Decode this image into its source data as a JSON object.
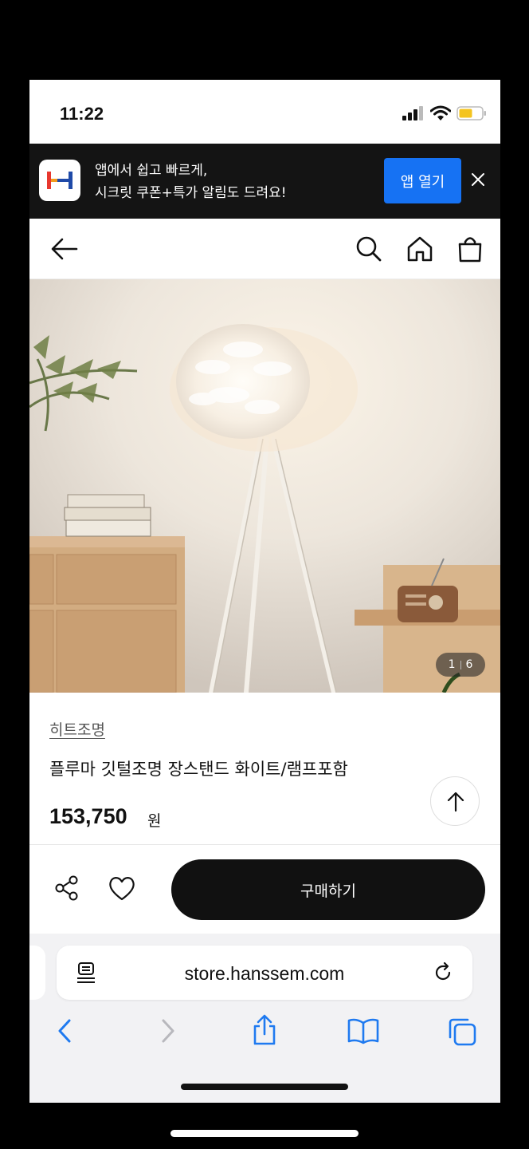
{
  "status_bar": {
    "time": "11:22"
  },
  "app_banner": {
    "line1": "앱에서 쉽고 빠르게,",
    "line2": "시크릿 쿠폰+특가 알림도 드려요!",
    "open_button": "앱 열기",
    "accent": "#1672f3"
  },
  "header": {
    "icons": [
      "back-arrow-icon",
      "search-icon",
      "home-icon",
      "shopping-bag-icon"
    ]
  },
  "gallery": {
    "current": "1",
    "total": "6"
  },
  "product": {
    "brand": "히트조명",
    "title": "플루마 깃털조명 장스탠드 화이트/램프포함",
    "price": "153,750",
    "currency": "원"
  },
  "actions": {
    "buy_label": "구매하기"
  },
  "browser": {
    "url": "store.hanssem.com",
    "icons": [
      "reader-icon",
      "reload-icon",
      "back-icon",
      "forward-icon",
      "share-icon",
      "bookmarks-icon",
      "tabs-icon"
    ]
  }
}
